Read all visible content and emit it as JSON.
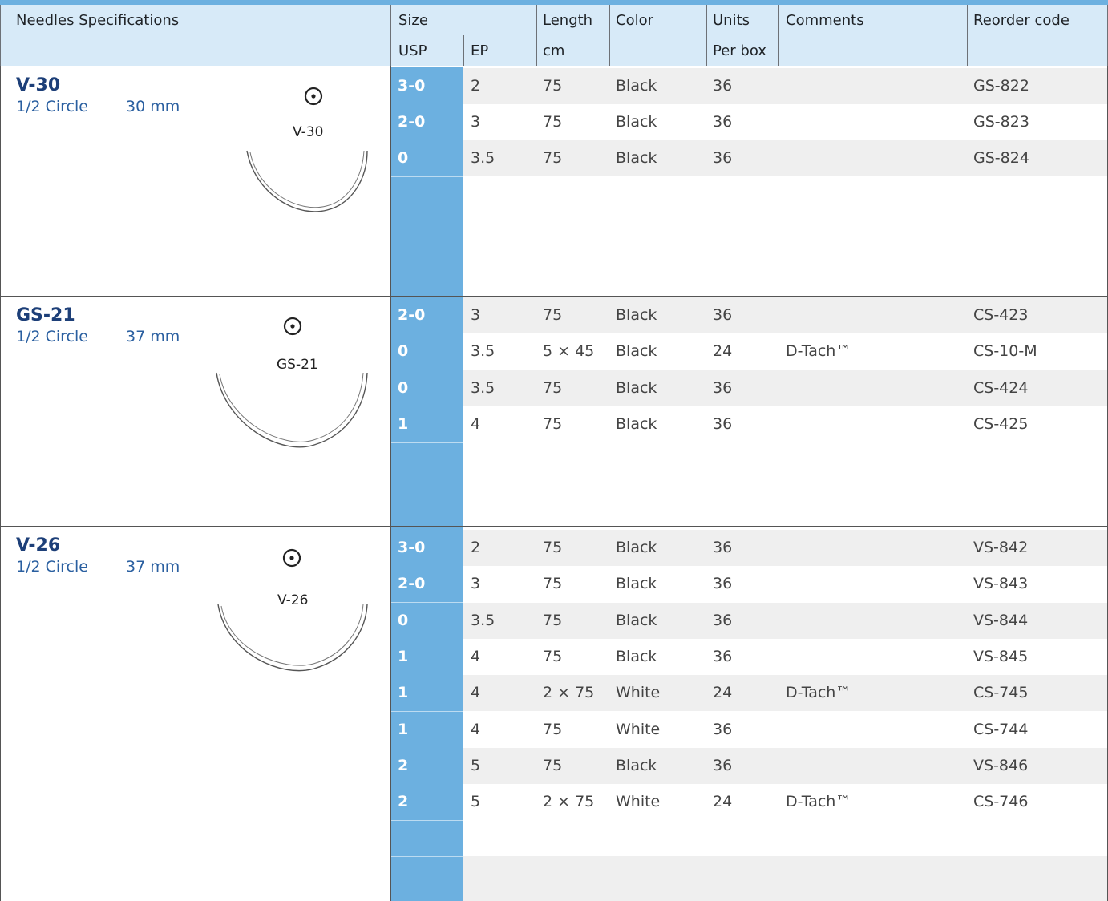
{
  "header": {
    "needles_spec": "Needles Specifications",
    "size": "Size",
    "usp": "USP",
    "ep": "EP",
    "length": "Length",
    "length_unit": "cm",
    "color": "Color",
    "units": "Units",
    "units_sub": "Per box",
    "comments": "Comments",
    "reorder": "Reorder code"
  },
  "sections": [
    {
      "name": "V-30",
      "type": "1/2 Circle",
      "size": "30 mm",
      "image_label": "V-30",
      "rows": [
        {
          "usp": "3-0",
          "ep": "2",
          "length": "75",
          "color": "Black",
          "units": "36",
          "comment": "",
          "code": "GS-822"
        },
        {
          "usp": "2-0",
          "ep": "3",
          "length": "75",
          "color": "Black",
          "units": "36",
          "comment": "",
          "code": "GS-823"
        },
        {
          "usp": "0",
          "ep": "3.5",
          "length": "75",
          "color": "Black",
          "units": "36",
          "comment": "",
          "code": "GS-824"
        }
      ]
    },
    {
      "name": "GS-21",
      "type": "1/2 Circle",
      "size": "37 mm",
      "image_label": "GS-21",
      "rows": [
        {
          "usp": "2-0",
          "ep": "3",
          "length": "75",
          "color": "Black",
          "units": "36",
          "comment": "",
          "code": "CS-423"
        },
        {
          "usp": "0",
          "ep": "3.5",
          "length": "5 × 45",
          "color": "Black",
          "units": "24",
          "comment": "D-Tach™",
          "code": "CS-10-M"
        },
        {
          "usp": "0",
          "ep": "3.5",
          "length": "75",
          "color": "Black",
          "units": "36",
          "comment": "",
          "code": "CS-424"
        },
        {
          "usp": "1",
          "ep": "4",
          "length": "75",
          "color": "Black",
          "units": "36",
          "comment": "",
          "code": "CS-425"
        }
      ]
    },
    {
      "name": "V-26",
      "type": "1/2 Circle",
      "size": "37 mm",
      "image_label": "V-26",
      "rows": [
        {
          "usp": "3-0",
          "ep": "2",
          "length": "75",
          "color": "Black",
          "units": "36",
          "comment": "",
          "code": "VS-842"
        },
        {
          "usp": "2-0",
          "ep": "3",
          "length": "75",
          "color": "Black",
          "units": "36",
          "comment": "",
          "code": "VS-843"
        },
        {
          "usp": "0",
          "ep": "3.5",
          "length": "75",
          "color": "Black",
          "units": "36",
          "comment": "",
          "code": "VS-844"
        },
        {
          "usp": "1",
          "ep": "4",
          "length": "75",
          "color": "Black",
          "units": "36",
          "comment": "",
          "code": "VS-845"
        },
        {
          "usp": "1",
          "ep": "4",
          "length": "2 × 75",
          "color": "White",
          "units": "24",
          "comment": "D-Tach™",
          "code": "CS-745"
        },
        {
          "usp": "1",
          "ep": "4",
          "length": "75",
          "color": "White",
          "units": "36",
          "comment": "",
          "code": "CS-744"
        },
        {
          "usp": "2",
          "ep": "5",
          "length": "75",
          "color": "Black",
          "units": "36",
          "comment": "",
          "code": "VS-846"
        },
        {
          "usp": "2",
          "ep": "5",
          "length": "2 × 75",
          "color": "White",
          "units": "24",
          "comment": "D-Tach™",
          "code": "CS-746"
        }
      ]
    }
  ]
}
